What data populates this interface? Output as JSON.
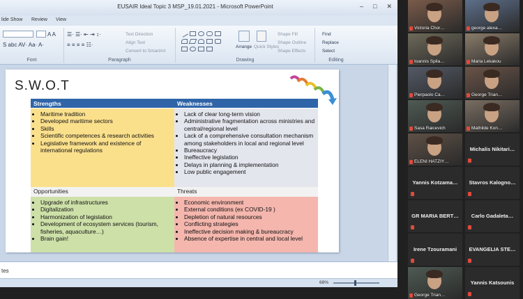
{
  "ppt": {
    "window_title": "EUSAIR Ideal Topic 3 MSP_19.01.2021 - Microsoft PowerPoint",
    "window_buttons": [
      "–",
      "□",
      "✕"
    ],
    "menu": [
      "lide Show",
      "Review",
      "View"
    ],
    "ribbon": {
      "font_group_label": "Font",
      "paragraph_group_label": "Paragraph",
      "drawing_group_label": "Drawing",
      "editing_group_label": "Editing",
      "text_direction": "Text Direction",
      "align_text": "Align Text",
      "convert_smartart": "Convert to SmartArt",
      "arrange": "Arrange",
      "quick_styles": "Quick Styles",
      "shape_fill": "Shape Fill",
      "shape_outline": "Shape Outline",
      "shape_effects": "Shape Effects",
      "find": "Find",
      "replace": "Replace",
      "select": "Select"
    },
    "slide": {
      "title": "S.W.O.T",
      "strengths_header": "Strengths",
      "weaknesses_header": "Weaknesses",
      "opportunities_header": "Opportunities",
      "threats_header": "Threats",
      "strengths": [
        "Maritime tradition",
        "Developed maritime sectors",
        "Skills",
        "Scientific competences & research activities",
        "Legislative framework and existence of international regulations"
      ],
      "weaknesses": [
        "Lack of clear long-term vision",
        "Administrative fragmentation across ministries and central/regional level",
        "Lack of a comprehensive consultation mechanism among stakeholders in local and regional level",
        "Bureaucracy",
        "Ineffective legislation",
        "Delays in planning & implementation",
        "Low public engagement"
      ],
      "opportunities": [
        "Upgrade of infrastructures",
        "Digitalization",
        "Harmonization of legislation",
        "Development of ecosystem services (tourism, fisheries, aquaculture…)",
        "Brain gain!"
      ],
      "threats": [
        "Economic environment",
        "External conditions (ex COVID-19 )",
        "Depletion of natural resources",
        "Conflicting strategies",
        "Ineffective decision making & bureaucracy",
        "Absence of expertise in central and local level"
      ],
      "colors": {
        "header_blue": "#2f64a8",
        "strengths_bg": "#fbe08c",
        "weaknesses_bg": "#e4e6ee",
        "opportunities_bg": "#cde0a8",
        "threats_bg": "#f4b6ad"
      }
    },
    "notes_text": "tes",
    "zoom": "68%"
  },
  "participants": [
    {
      "name": "Victoria Chor…",
      "video": true
    },
    {
      "name": "george alexa…",
      "video": true
    },
    {
      "name": "Ioannis Spila…",
      "video": true
    },
    {
      "name": "Maria Lekakou",
      "video": true
    },
    {
      "name": "Pierpaolo Ca…",
      "video": true
    },
    {
      "name": "George Trian…",
      "video": true
    },
    {
      "name": "Sasa Raicevich",
      "video": true
    },
    {
      "name": "Mathilde Kon…",
      "video": true
    },
    {
      "name": "ELENI HATZIY…",
      "video": true
    },
    {
      "name": "Michalis Nikitari…",
      "video": false
    },
    {
      "name": "Yannis Kotzama…",
      "video": false
    },
    {
      "name": "Stavros Kalogno…",
      "video": false
    },
    {
      "name": "GR MARIA BERT…",
      "video": false
    },
    {
      "name": "Carlo Gadaleta…",
      "video": false
    },
    {
      "name": "Irene Tzouramani",
      "video": false
    },
    {
      "name": "EVANGELIA STE…",
      "video": false
    },
    {
      "name": "George Trian…",
      "video": true
    },
    {
      "name": "Yannis Katsounis",
      "video": false
    }
  ]
}
